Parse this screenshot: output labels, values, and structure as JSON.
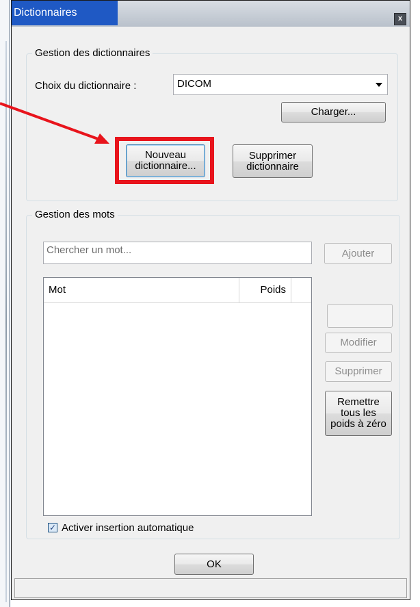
{
  "window": {
    "title": "Dictionnaires",
    "close_glyph": "x"
  },
  "dictionaries_group": {
    "legend": "Gestion des dictionnaires",
    "choice_label": "Choix du dictionnaire :",
    "selected_dictionary": "DICOM",
    "load_button": "Charger...",
    "new_button_line1": "Nouveau",
    "new_button_line2": "dictionnaire...",
    "delete_button_line1": "Supprimer",
    "delete_button_line2": "dictionnaire"
  },
  "words_group": {
    "legend": "Gestion des mots",
    "search_placeholder": "Chercher un mot...",
    "add_button": "Ajouter",
    "columns": [
      "Mot",
      "Poids"
    ],
    "edit_button": "Modifier",
    "delete_button": "Supprimer",
    "reset_line1": "Remettre",
    "reset_line2": "tous les",
    "reset_line3": "poids à zéro",
    "auto_insert_label": "Activer insertion automatique",
    "auto_insert_checked": true
  },
  "ok_button": "OK",
  "annotation": {
    "highlight_color": "#e8141c"
  }
}
